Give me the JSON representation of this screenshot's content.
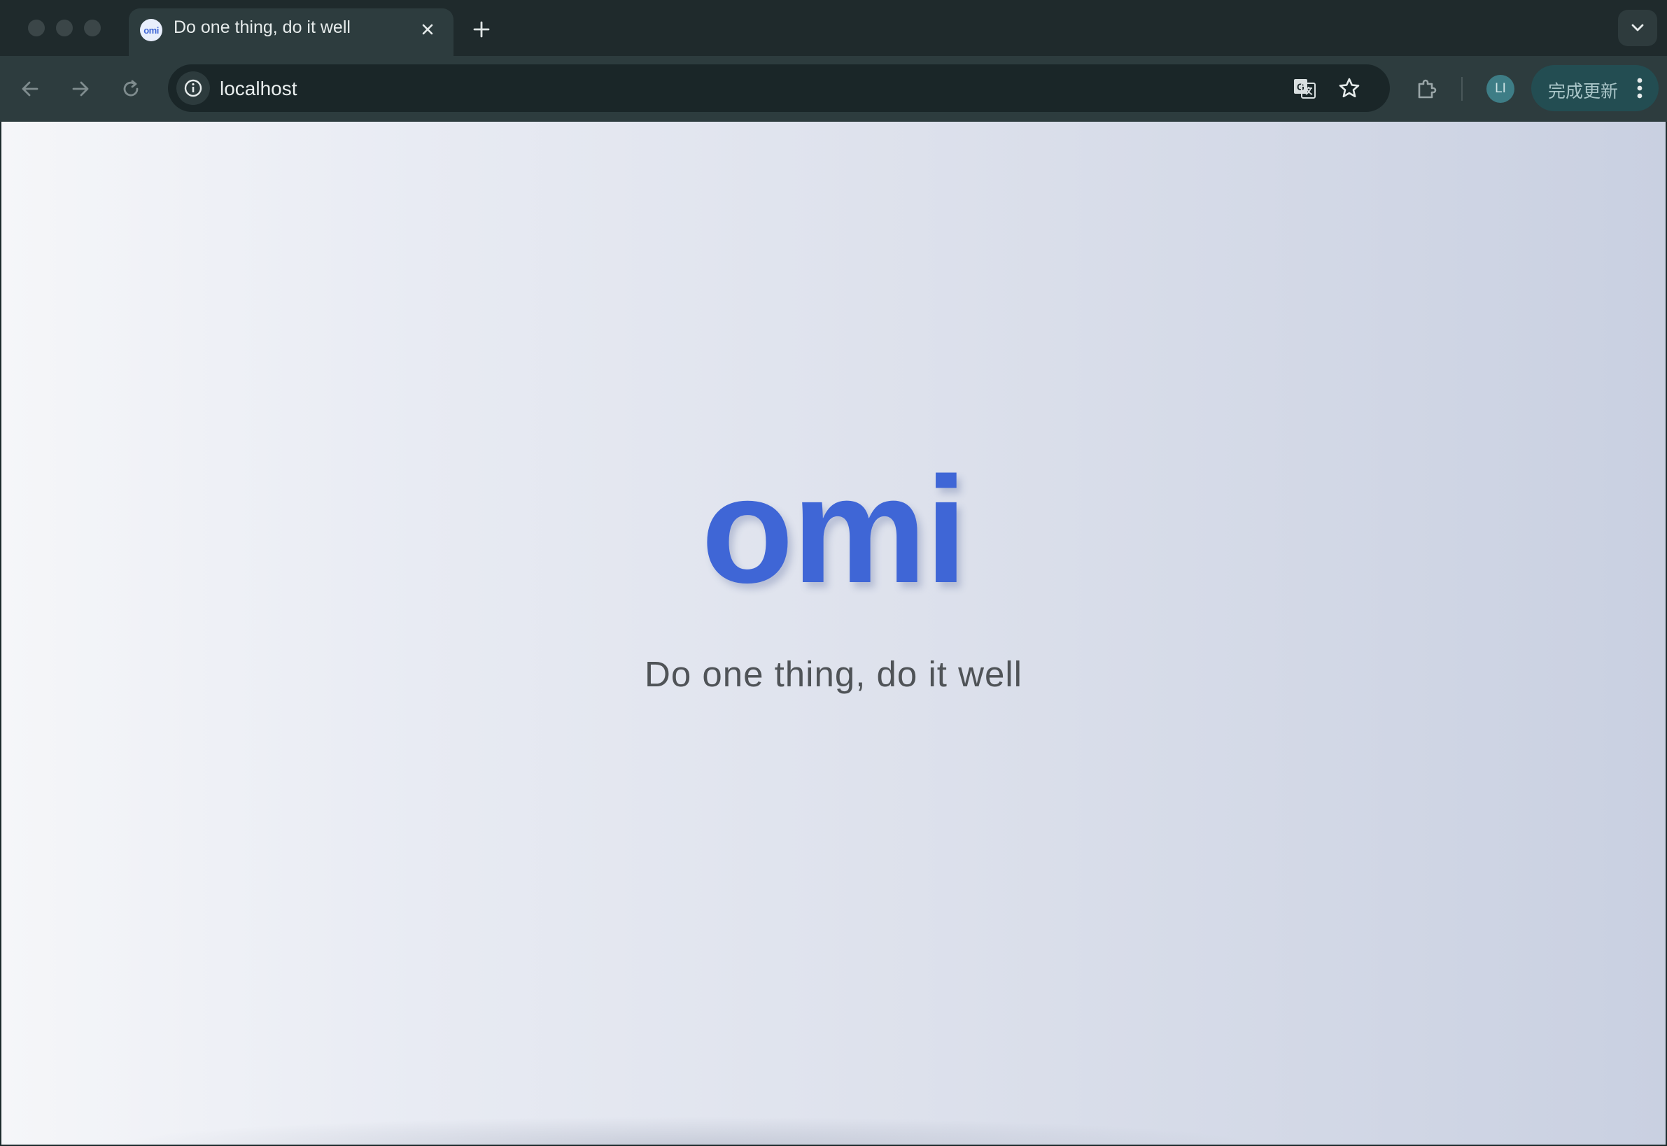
{
  "browser": {
    "tab": {
      "title": "Do one thing, do it well",
      "favicon_text": "omi",
      "close_icon": "close-icon"
    },
    "new_tab_icon": "plus-icon",
    "tab_search_icon": "chevron-down-icon",
    "toolbar": {
      "back_icon": "arrow-left-icon",
      "forward_icon": "arrow-right-icon",
      "reload_icon": "reload-icon",
      "url": "localhost",
      "site_info_icon": "info-icon",
      "translate_icon": "translate-icon",
      "bookmark_icon": "star-icon",
      "extensions_icon": "puzzle-icon",
      "profile_initials": "LI",
      "update_label": "完成更新",
      "menu_icon": "more-vertical-icon"
    },
    "colors": {
      "frame": "#1f2a2c",
      "toolbar": "#2d3c3e",
      "omnibox": "#1a2628",
      "update_button": "#234d52",
      "avatar": "#3e7d86"
    }
  },
  "page": {
    "logo": "omi",
    "tagline": "Do one thing, do it well",
    "colors": {
      "logo": "#3f66d6",
      "tagline": "#4f5357",
      "background_start": "#f5f6f9",
      "background_end": "#c9d0e1"
    }
  }
}
